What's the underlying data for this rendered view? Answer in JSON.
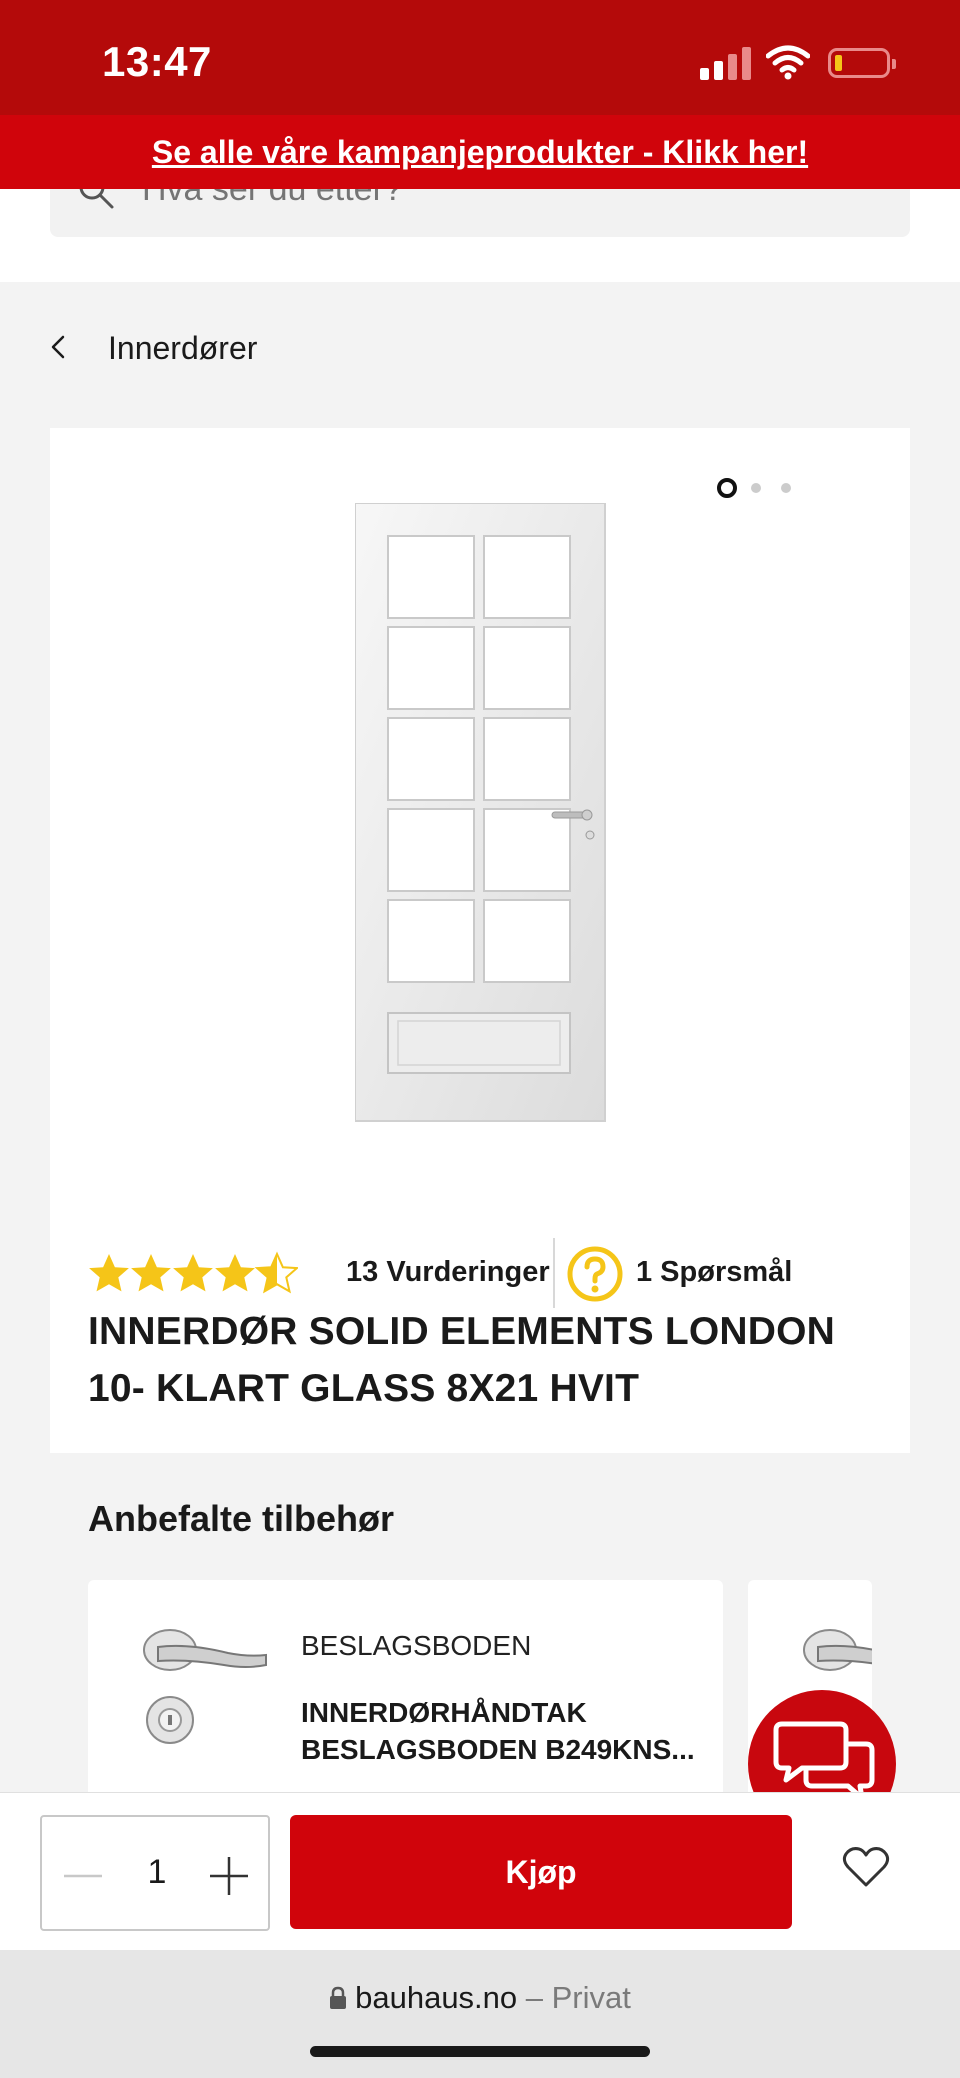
{
  "status_bar": {
    "time": "13:47",
    "battery_level": 0.1
  },
  "promo_banner": {
    "text": "Se alle våre kampanjeprodukter - Klikk her!"
  },
  "search": {
    "placeholder": "Hva ser du etter?"
  },
  "breadcrumb": {
    "label": "Innerdører"
  },
  "carousel": {
    "total": 3,
    "active": 1
  },
  "product": {
    "rating": 4.5,
    "reviews_label": "13 Vurderinger",
    "questions_label": "1 Spørsmål",
    "title": "INNERDØR SOLID ELEMENTS LONDON 10- KLART GLASS 8X21 HVIT"
  },
  "accessories": {
    "title": "Anbefalte tilbehør",
    "items": [
      {
        "brand": "BESLAGSBODEN",
        "name": "INNERDØRHÅNDTAK BESLAGSBODEN B249KNS..."
      }
    ]
  },
  "buy_bar": {
    "quantity": "1",
    "buy_label": "Kjøp"
  },
  "browser": {
    "domain": "bauhaus.no",
    "mode": "– Privat"
  },
  "colors": {
    "brand_red": "#d0040b",
    "status_red": "#b40a0a",
    "star_yellow": "#f5c518"
  },
  "icons": [
    "search-icon",
    "chevron-left-icon",
    "star-icon",
    "question-icon",
    "minus-icon",
    "plus-icon",
    "heart-icon",
    "chat-icon",
    "lock-icon"
  ]
}
